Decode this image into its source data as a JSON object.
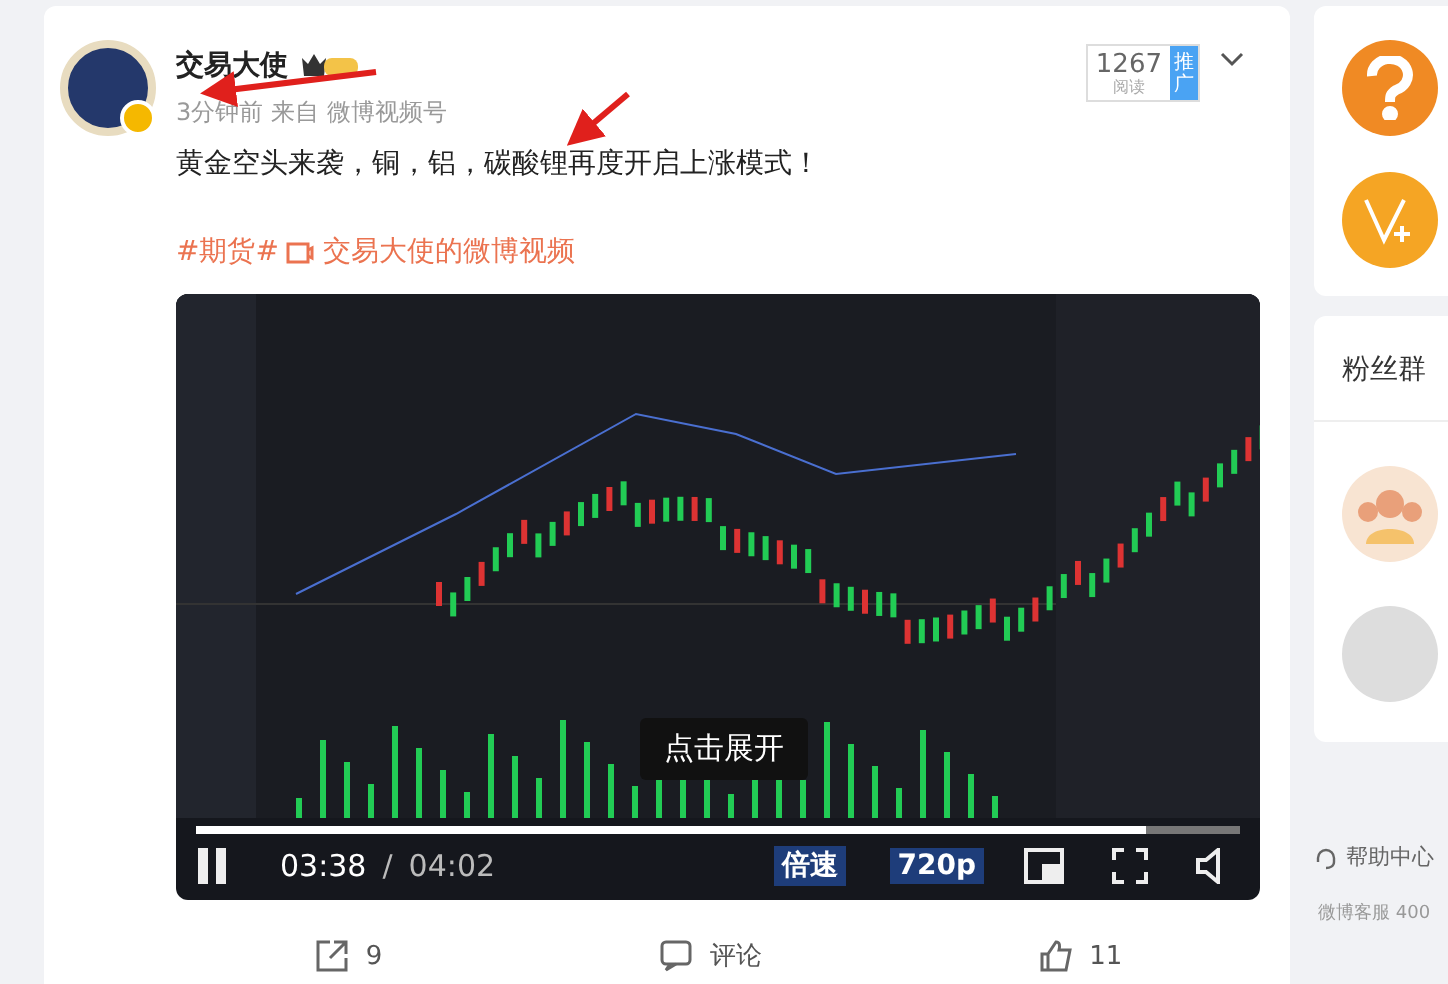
{
  "post": {
    "author": "交易大使",
    "time": "3分钟前",
    "source_prefix": "来自",
    "source": "微博视频号",
    "reads": "1267",
    "reads_label": "阅读",
    "promote": "推广",
    "text": "黄金空头来袭，铜，铝，碳酸锂再度开启上涨模式！",
    "topic": "#期货#",
    "video_link": "交易大使的微博视频",
    "video": {
      "overlay": "点击展开",
      "elapsed": "03:38",
      "separator": "/",
      "duration": "04:02",
      "speed": "倍速",
      "quality": "720p",
      "playing": true,
      "progress": {
        "level": 0.91
      }
    },
    "actions": [
      {
        "kind": "share",
        "label": "9"
      },
      {
        "kind": "comment",
        "label": "评论"
      },
      {
        "kind": "like",
        "label": "11"
      }
    ]
  },
  "sidebar": {
    "fan_group_title": "粉丝群",
    "help": "帮助中心",
    "hotline": "微博客服 400"
  }
}
